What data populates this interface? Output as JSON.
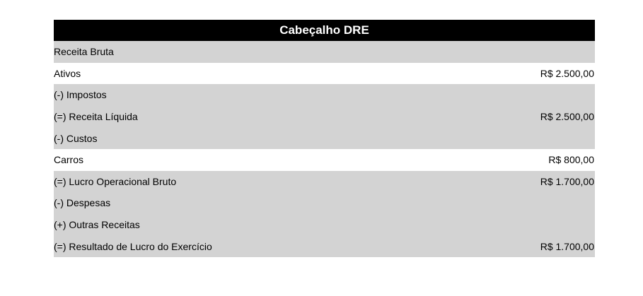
{
  "table": {
    "title": "Cabeçalho DRE",
    "rows": [
      {
        "label": "Receita Bruta",
        "value": "",
        "shaded": true
      },
      {
        "label": "Ativos",
        "value": "R$ 2.500,00",
        "shaded": false
      },
      {
        "label": "(-) Impostos",
        "value": "",
        "shaded": true
      },
      {
        "label": "(=) Receita Líquida",
        "value": "R$ 2.500,00",
        "shaded": true
      },
      {
        "label": "(-) Custos",
        "value": "",
        "shaded": true
      },
      {
        "label": "Carros",
        "value": "R$ 800,00",
        "shaded": false
      },
      {
        "label": "(=) Lucro Operacional Bruto",
        "value": "R$ 1.700,00",
        "shaded": true
      },
      {
        "label": "(-) Despesas",
        "value": "",
        "shaded": true
      },
      {
        "label": "(+) Outras Receitas",
        "value": "",
        "shaded": true
      },
      {
        "label": "(=) Resultado de Lucro do Exercício",
        "value": "R$ 1.700,00",
        "shaded": true
      }
    ]
  },
  "colors": {
    "header_bg": "#000000",
    "header_text": "#ffffff",
    "shaded_row": "#d3d3d3",
    "plain_row": "#ffffff"
  }
}
